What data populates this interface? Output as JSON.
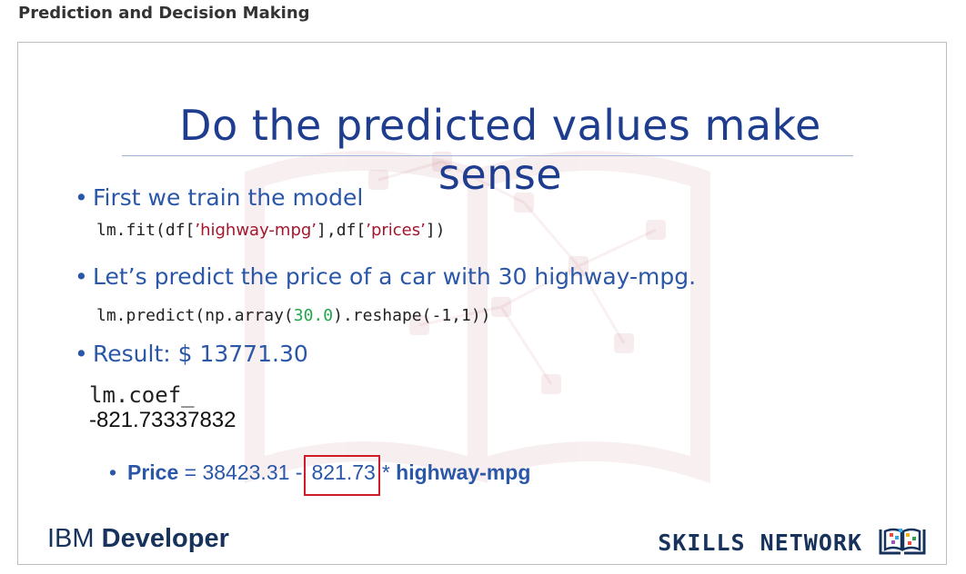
{
  "page": {
    "heading": "Prediction and Decision Making"
  },
  "slide": {
    "title": "Do the predicted values make sense",
    "bullets": [
      {
        "text": "First we train the model",
        "code": {
          "prefix": "lm.fit(df[",
          "arg1": "’highway-mpg’",
          "mid": "],df[",
          "arg2": "’prices’",
          "suffix": "])"
        }
      },
      {
        "text": "Let’s predict the price of a car with 30 highway-mpg.",
        "code": {
          "prefix": "lm.predict(np.array(",
          "number": "30.0",
          "suffix": ").reshape(-1,1))"
        }
      },
      {
        "text": "Result: $ 13771.30"
      }
    ],
    "coef": {
      "label": "lm.coef_",
      "value": "-821.73337832"
    },
    "equation": {
      "price_label": "Price",
      "equals_intercept": " = 38423.31 -",
      "highlighted_coef": "821.73",
      "times": "* ",
      "variable": "highway-mpg"
    },
    "footer": {
      "ibm": "IBM",
      "developer": "Developer",
      "skills_network": "SKILLS NETWORK"
    }
  },
  "colors": {
    "title": "#1f3d8f",
    "bullet_text": "#2a57a8",
    "code_string": "#a3162c",
    "code_number": "#22a64a",
    "highlight_border": "#d01c2a",
    "footer_text": "#17335c"
  },
  "icons": [
    "bullet-dot-icon",
    "skills-network-logo-icon",
    "book-network-watermark-icon"
  ]
}
